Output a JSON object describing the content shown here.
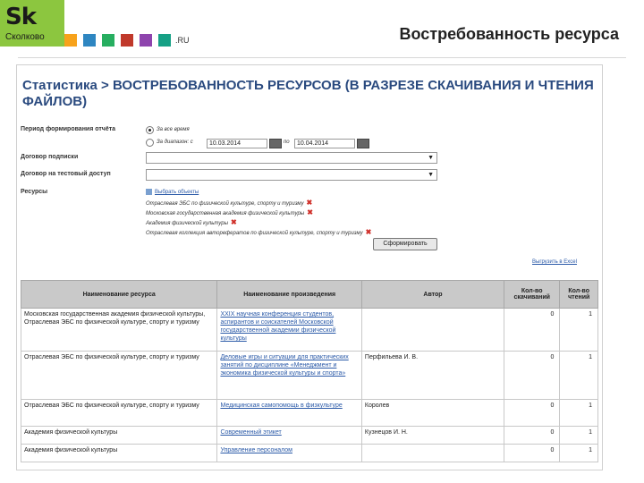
{
  "slide": {
    "logo_mark": "Sk",
    "logo_name": "Сколково",
    "domain_suffix": ".RU",
    "ruseo_colors": [
      "#f7a21b",
      "#2e86c1",
      "#27ae60",
      "#c0392b",
      "#8e44ad",
      "#16a085",
      "#e67e22"
    ],
    "title": "Востребованность ресурса"
  },
  "page": {
    "title": "Статистика > ВОСТРЕБОВАННОСТЬ РЕСУРСОВ (В РАЗРЕЗЕ СКАЧИВАНИЯ И ЧТЕНИЯ ФАЙЛОВ)"
  },
  "form": {
    "period_label": "Период формирования отчёта",
    "all_time_option": "За все время",
    "range_option": "За диапазон: с",
    "date_from": "10.03.2014",
    "date_to_prefix": "по",
    "date_to": "10.04.2014",
    "subscription_label": "Договор подписки",
    "trial_label": "Договор на тестовый доступ",
    "resources_label": "Ресурсы",
    "choose_objects": "Выбрать объекты",
    "resources": [
      "Отраслевая ЭБС по физической культуре, спорту и туризму",
      "Московская государственная академия физической культуры",
      "Академия физической культуры",
      "Отраслевая коллекция авторефератов по физической культуре, спорту и туризму"
    ],
    "submit_label": "Сформировать",
    "excel_link": "Выгрузить в Excel"
  },
  "table": {
    "headers": [
      "Наименование ресурса",
      "Наименование произведения",
      "Автор",
      "Кол-во скачиваний",
      "Кол-во чтений"
    ],
    "rows": [
      {
        "resource": "Московская государственная академия физической культуры, Отраслевая ЭБС по физической культуре, спорту и туризму",
        "work": "XXIX научная конференция студентов, аспирантов и соискателей Московской государственной академии физической культуры",
        "author": "",
        "downloads": "0",
        "reads": "1"
      },
      {
        "resource": "Отраслевая ЭБС по физической культуре, спорту и туризму",
        "work": "Деловые игры и ситуации для практических занятий по дисциплине «Менеджмент и экономика физической культуры и спорта»",
        "author": "Перфильева И. В.",
        "downloads": "0",
        "reads": "1"
      },
      {
        "resource": "Отраслевая ЭБС по физической культуре, спорту и туризму",
        "work": "Медицинская самопомощь в физкультуре",
        "author": "Королев",
        "downloads": "0",
        "reads": "1"
      },
      {
        "resource": "Академия физической культуры",
        "work": "Современный этикет",
        "author": "Кузнецов И. Н.",
        "downloads": "0",
        "reads": "1"
      },
      {
        "resource": "Академия физической культуры",
        "work": "Управление персоналом",
        "author": "",
        "downloads": "0",
        "reads": "1"
      }
    ]
  }
}
